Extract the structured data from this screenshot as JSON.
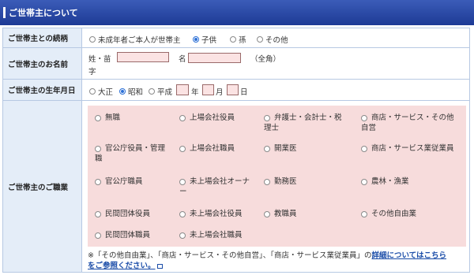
{
  "header": {
    "title": "ご世帯主について"
  },
  "relation": {
    "label": "ご世帯主との続柄",
    "options": [
      "未成年者ご本人が世帯主",
      "子供",
      "孫",
      "その他"
    ],
    "selected": "子供"
  },
  "name": {
    "label": "ご世帯主のお名前",
    "sei_label": "姓・苗",
    "sei_label2": "字",
    "mei_label": "名",
    "note": "（全角）",
    "sei_value": "",
    "mei_value": ""
  },
  "birth": {
    "label": "ご世帯主の生年月日",
    "eras": [
      "大正",
      "昭和",
      "平成"
    ],
    "selected": "昭和",
    "year": "年",
    "month": "月",
    "day": "日"
  },
  "job": {
    "label": "ご世帯主のご職業",
    "options": [
      [
        "無職",
        "上場会社役員",
        "弁護士・会計士・税",
        "理士",
        "商店・サービス・その他",
        "自営"
      ],
      [
        "官公庁役員・管理",
        "職",
        "上場会社職員",
        "開業医",
        "商店・サービス業従業員"
      ],
      [
        "官公庁職員",
        "未上場会社オーナ",
        "ー",
        "勤務医",
        "農林・漁業"
      ],
      [
        "民間団体役員",
        "未上場会社役員",
        "教職員",
        "その他自由業"
      ],
      [
        "民間団体職員",
        "未上場会社職員"
      ]
    ],
    "note_text": "※「その他自由業」、「商店・サービス・その他自営」、「商店・サービス業従業員」の",
    "note_link1": "詳細についてはこちら",
    "note_link2": "をご参照ください。"
  },
  "colors": {
    "header": "#2a4aa8",
    "label_bg": "#e4edf8",
    "job_bg": "#f7dcdc",
    "link": "#1a4ca8"
  }
}
